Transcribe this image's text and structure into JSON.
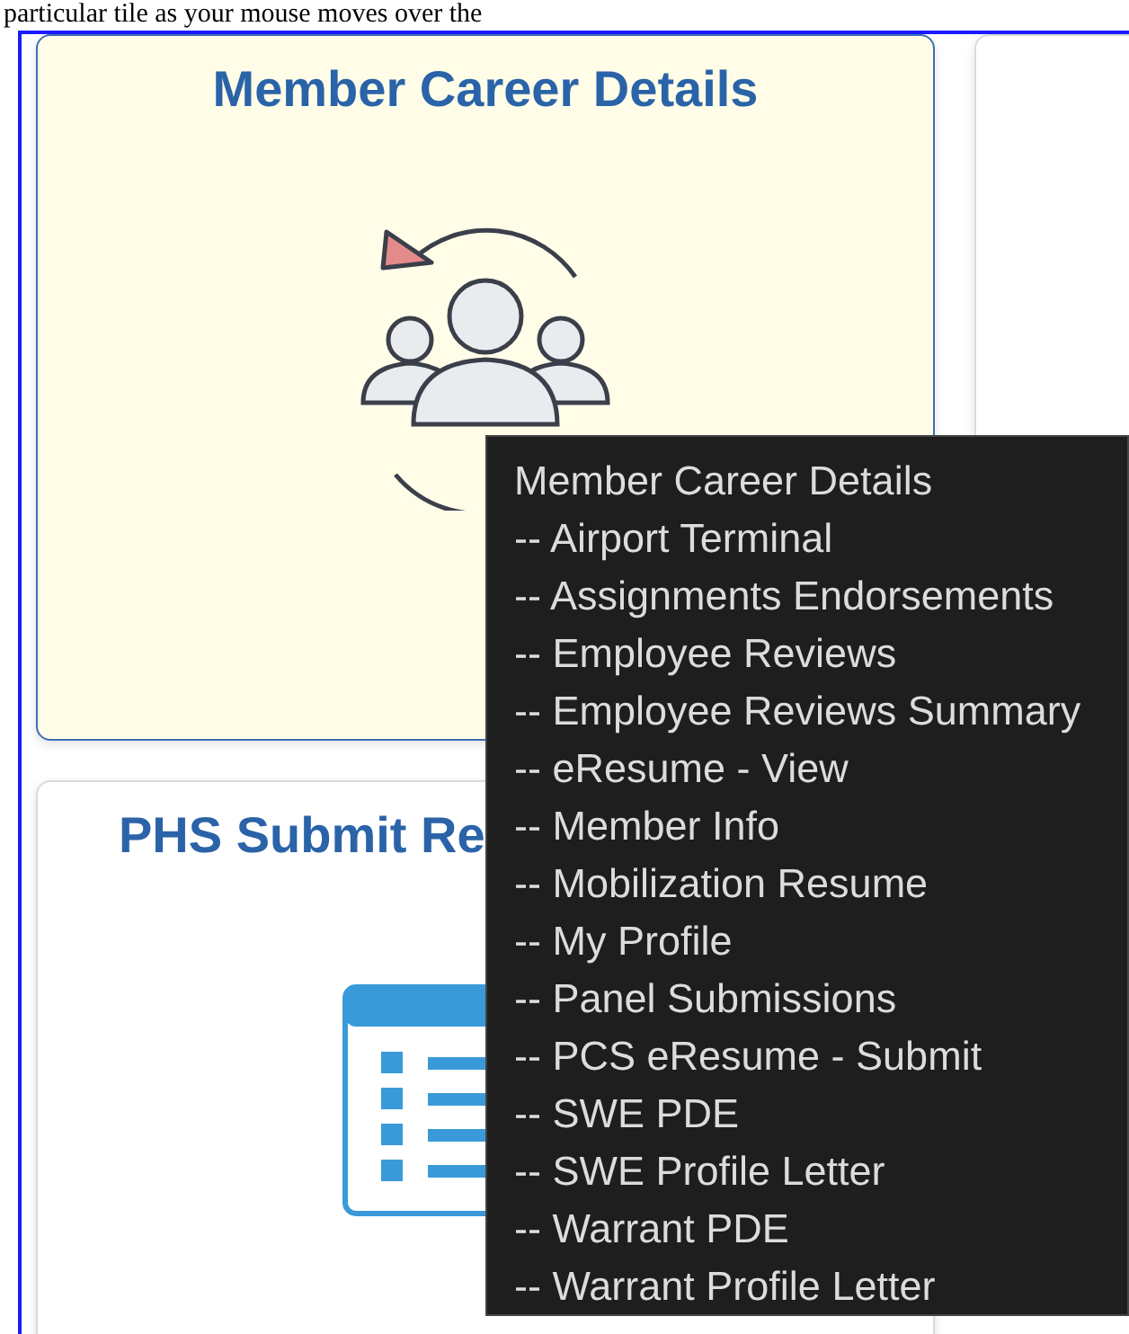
{
  "caption": "particular tile as your mouse moves over the",
  "tiles": [
    {
      "title": "Member Career Details",
      "kind": "people",
      "hovered": true
    },
    {
      "kind": "blank",
      "hovered": false
    },
    {
      "title": "PHS Submit Re",
      "kind": "list",
      "hovered": false
    }
  ],
  "tooltip": {
    "title": "Member Career Details",
    "items": [
      "-- Airport Terminal",
      "-- Assignments Endorsements",
      "-- Employee Reviews",
      "-- Employee Reviews Summary",
      "-- eResume - View",
      "-- Member Info",
      "-- Mobilization Resume",
      "-- My Profile",
      "-- Panel Submissions",
      "-- PCS eResume - Submit",
      "-- SWE PDE",
      "-- SWE Profile Letter",
      "-- Warrant PDE",
      "-- Warrant Profile Letter"
    ]
  }
}
